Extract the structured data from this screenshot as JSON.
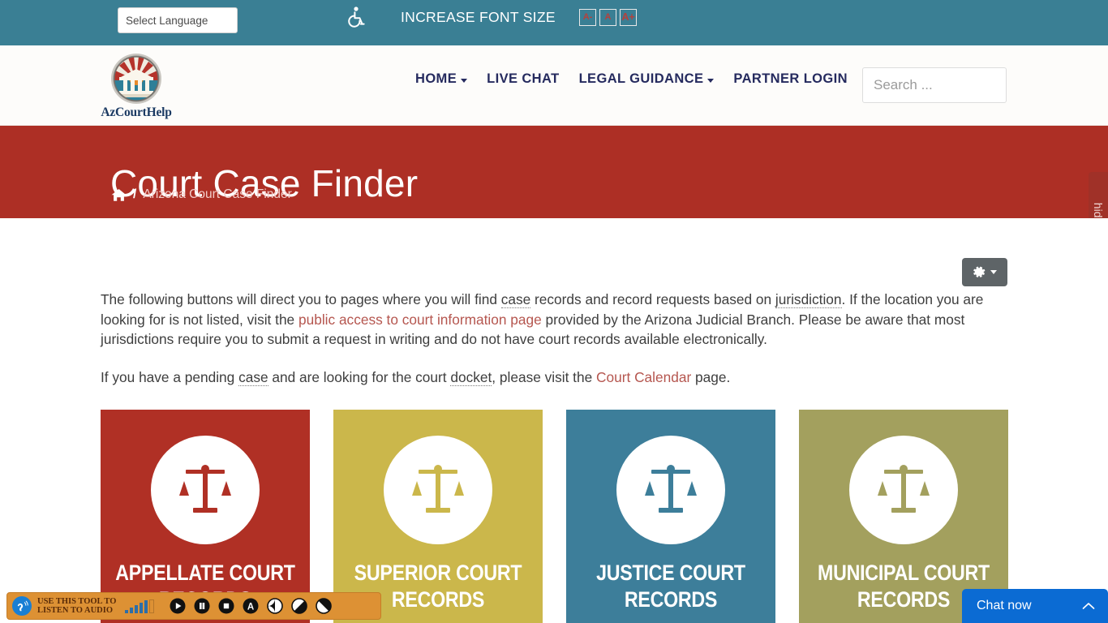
{
  "topbar": {
    "language_selector": "Select Language",
    "accessibility_icon": "wheelchair-icon",
    "increase_font_label": "INCREASE FONT SIZE",
    "font_buttons": [
      {
        "label": "A-",
        "name": "decrease-font-button"
      },
      {
        "label": "A",
        "name": "reset-font-button"
      },
      {
        "label": "A+",
        "name": "increase-font-button"
      }
    ],
    "bg_color": "#3a7f94"
  },
  "header": {
    "logo_text": "AzCourtHelp",
    "nav": [
      {
        "label": "HOME",
        "has_caret": true
      },
      {
        "label": "LIVE CHAT",
        "has_caret": false
      },
      {
        "label": "LEGAL GUIDANCE",
        "has_caret": true
      },
      {
        "label": "PARTNER LOGIN",
        "has_caret": false
      }
    ],
    "search_placeholder": "Search ...",
    "search_value": ""
  },
  "hero": {
    "title": "Court Case Finder",
    "breadcrumb_home_icon": "home-icon",
    "breadcrumb_separator": "/",
    "breadcrumb_current": "Arizona Court Case Finder",
    "bg_color": "#ad2f25"
  },
  "side_tab": {
    "label": "hide screen",
    "color": "#a03128"
  },
  "main": {
    "settings_button": {
      "icon": "gear-icon",
      "caret": "chevron-down-icon"
    },
    "paragraph1": {
      "seg1": "The following buttons will direct you to pages where you will find ",
      "term1": "case",
      "seg2": " records and record requests based on ",
      "term2": "jurisdiction",
      "seg3": ".  If the location you are looking for is not listed, visit the ",
      "link1": "public access to court information page",
      "seg4": " provided by the Arizona Judicial Branch.  Please be aware that most jurisdictions require you to submit a request in writing and do not have court records available electronically."
    },
    "paragraph2": {
      "seg1": "If you have a pending ",
      "term1": "case",
      "seg2": " and are looking for the court ",
      "term2": "docket",
      "seg3": ", please visit the ",
      "link1": "Court Calendar",
      "seg4": " page."
    },
    "cards": [
      {
        "label": "APPELLATE COURT RECORDS",
        "color": "#b03025",
        "icon": "scales-of-justice-icon"
      },
      {
        "label": "SUPERIOR COURT RECORDS",
        "color": "#cbb74b",
        "icon": "scales-of-justice-icon"
      },
      {
        "label": "JUSTICE COURT RECORDS",
        "color": "#3d7e9a",
        "icon": "scales-of-justice-icon"
      },
      {
        "label": "MUNICIPAL COURT RECORDS",
        "color": "#a3a05e",
        "icon": "scales-of-justice-icon"
      }
    ]
  },
  "readspeaker": {
    "icon": "ear-listen-icon",
    "text_line1": "USE THIS TOOL TO",
    "text_line2": "LISTEN TO AUDIO",
    "volume_icon": "volume-bars-icon",
    "controls": [
      {
        "name": "play-button",
        "icon": "play-icon"
      },
      {
        "name": "pause-button",
        "icon": "pause-icon"
      },
      {
        "name": "stop-button",
        "icon": "stop-icon"
      },
      {
        "name": "font-settings-button",
        "icon": "letter-a-icon"
      },
      {
        "name": "contrast-button",
        "icon": "contrast-half-icon"
      },
      {
        "name": "contrast-alt-button",
        "icon": "contrast-diagonal-icon"
      },
      {
        "name": "contrast-invert-button",
        "icon": "contrast-invert-icon"
      }
    ],
    "bg_color": "#dd9134"
  },
  "chat": {
    "label": "Chat now",
    "chevron": "chevron-up-icon",
    "color": "#0b6bd3"
  }
}
